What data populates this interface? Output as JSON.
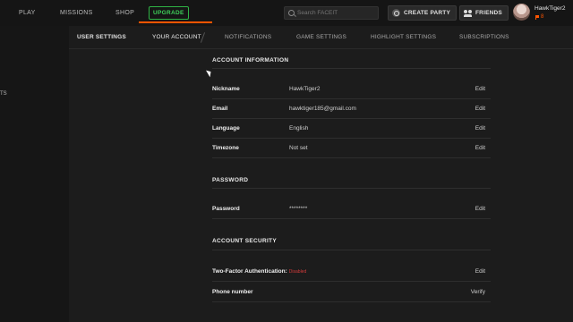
{
  "topnav": {
    "items": [
      "PLAY",
      "MISSIONS",
      "SHOP"
    ],
    "upgrade_label": "UPGRADE",
    "search_placeholder": "Search FACEIT",
    "create_party_label": "CREATE PARTY",
    "friends_label": "FRIENDS",
    "username": "HawkTiger2",
    "level": "8"
  },
  "sidebar": {
    "fragment": "TS"
  },
  "tabs": {
    "items": [
      "USER SETTINGS",
      "YOUR ACCOUNT",
      "NOTIFICATIONS",
      "GAME SETTINGS",
      "HIGHLIGHT SETTINGS",
      "SUBSCRIPTIONS"
    ],
    "active": "YOUR ACCOUNT"
  },
  "account_info": {
    "title": "ACCOUNT INFORMATION",
    "rows": [
      {
        "label": "Nickname",
        "value": "HawkTiger2",
        "action": "Edit"
      },
      {
        "label": "Email",
        "value": "hawktiger185@gmail.com",
        "action": "Edit"
      },
      {
        "label": "Language",
        "value": "English",
        "action": "Edit"
      },
      {
        "label": "Timezone",
        "value": "Not set",
        "action": "Edit"
      }
    ]
  },
  "password": {
    "title": "PASSWORD",
    "rows": [
      {
        "label": "Password",
        "value": "********",
        "action": "Edit"
      }
    ]
  },
  "security": {
    "title": "ACCOUNT SECURITY",
    "rows": [
      {
        "label": "Two-Factor Authentication:",
        "badge": "Disabled",
        "action": "Edit"
      },
      {
        "label": "Phone number",
        "action": "Verify"
      }
    ]
  },
  "colors": {
    "accent": "#ff5500",
    "upgrade": "#2fb344",
    "disabled": "#d43b3b"
  }
}
